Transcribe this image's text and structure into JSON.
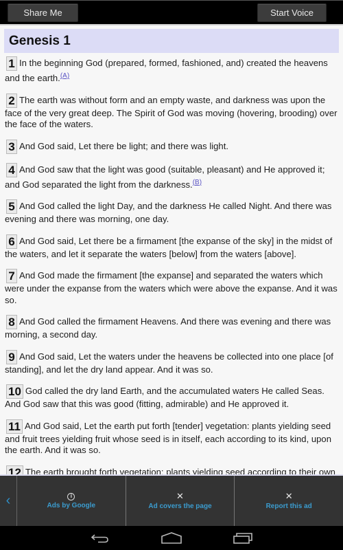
{
  "topbar": {
    "share_label": "Share Me",
    "voice_label": "Start Voice"
  },
  "chapter": {
    "title": "Genesis 1"
  },
  "verses": [
    {
      "num": "1",
      "text": "In the beginning God (prepared, formed, fashioned, and) created the heavens and the earth.",
      "footnote": "A"
    },
    {
      "num": "2",
      "text": "The earth was without form and an empty waste, and darkness was upon the face of the very great deep. The Spirit of God was moving (hovering, brooding) over the face of the waters.",
      "footnote": null
    },
    {
      "num": "3",
      "text": "And God said, Let there be light; and there was light.",
      "footnote": null
    },
    {
      "num": "4",
      "text": "And God saw that the light was good (suitable, pleasant) and He approved it; and God separated the light from the darkness.",
      "footnote": "B"
    },
    {
      "num": "5",
      "text": "And God called the light Day, and the darkness He called Night. And there was evening and there was morning, one day.",
      "footnote": null
    },
    {
      "num": "6",
      "text": "And God said, Let there be a firmament [the expanse of the sky] in the midst of the waters, and let it separate the waters [below] from the waters [above].",
      "footnote": null
    },
    {
      "num": "7",
      "text": "And God made the firmament [the expanse] and separated the waters which were under the expanse from the waters which were above the expanse. And it was so.",
      "footnote": null
    },
    {
      "num": "8",
      "text": "And God called the firmament Heavens. And there was evening and there was morning, a second day.",
      "footnote": null
    },
    {
      "num": "9",
      "text": "And God said, Let the waters under the heavens be collected into one place [of standing], and let the dry land appear. And it was so.",
      "footnote": null
    },
    {
      "num": "10",
      "text": "God called the dry land Earth, and the accumulated waters He called Seas. And God saw that this was good (fitting, admirable) and He approved it.",
      "footnote": null
    },
    {
      "num": "11",
      "text": "And God said, Let the earth put forth [tender] vegetation: plants yielding seed and fruit trees yielding fruit whose seed is in itself, each according to its kind, upon the earth. And it was so.",
      "footnote": null
    },
    {
      "num": "12",
      "text": "The earth brought forth vegetation: plants yielding seed according to their own kinds and trees bearing fruit in which was their seed, each according to its kind. And God saw that it was good (suitable, admirable) and He approved it.",
      "footnote": null
    }
  ],
  "adbar": {
    "back_icon": "chevron-left-icon",
    "items": [
      {
        "icon": "info-icon",
        "glyph": "i",
        "label": "Ads by Google"
      },
      {
        "icon": "close-icon",
        "glyph": "✕",
        "label": "Ad covers the page"
      },
      {
        "icon": "close-icon",
        "glyph": "✕",
        "label": "Report this ad"
      }
    ],
    "label_color": "#3b9ccf"
  },
  "navbar": {
    "buttons": [
      "back-icon",
      "home-icon",
      "recent-apps-icon"
    ]
  }
}
